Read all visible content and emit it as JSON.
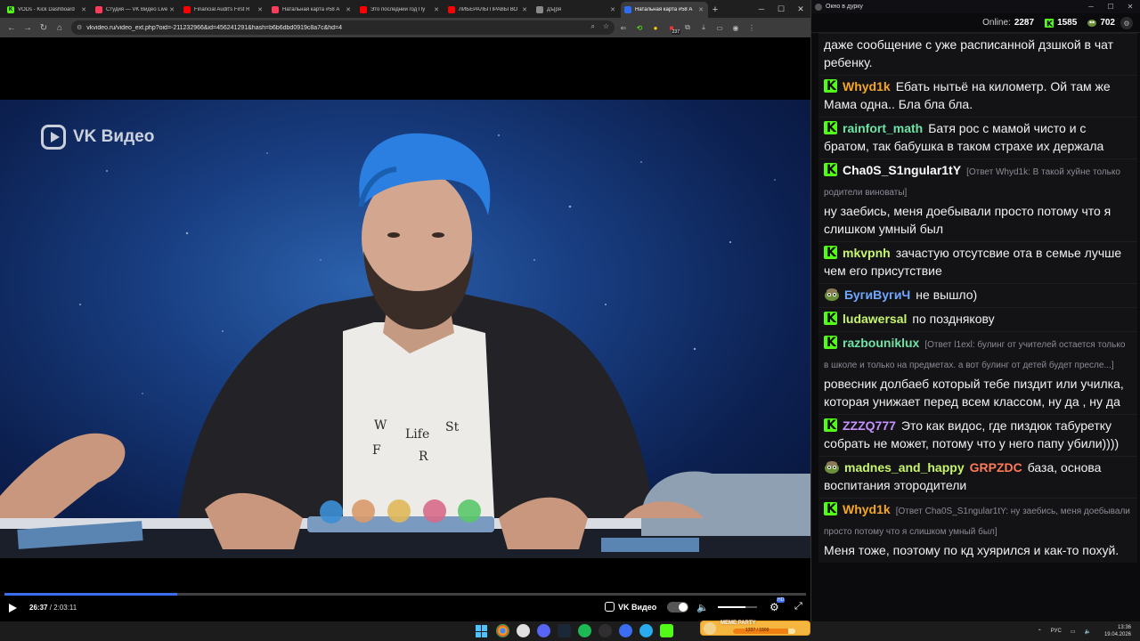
{
  "browser": {
    "tabs": [
      {
        "label": "VODs - Kick Dashboard",
        "icon": "kick-icon",
        "color": "#53fc18",
        "active": false
      },
      {
        "label": "Студия — VK Видео Live",
        "icon": "vk-studio-icon",
        "color": "#ff3b5c",
        "active": false
      },
      {
        "label": "Financial Audit's First R",
        "icon": "youtube-icon",
        "color": "#ff0000",
        "active": false
      },
      {
        "label": "Натальная карта #58 А",
        "icon": "vk-video-icon",
        "color": "#ff3b5c",
        "active": false
      },
      {
        "label": "Это последний год Пу",
        "icon": "youtube-icon",
        "color": "#ff0000",
        "active": false
      },
      {
        "label": "ЛИБЕРАЛЫ ПРАВЫ ВО",
        "icon": "youtube-icon",
        "color": "#ff0000",
        "active": false
      },
      {
        "label": "Дъ[ря",
        "icon": "generic-page-icon",
        "color": "#888888",
        "active": false
      },
      {
        "label": "Натальная карта #58 А",
        "icon": "vk-video-icon",
        "color": "#2f6cf5",
        "active": true
      }
    ],
    "url": "vkvideo.ru/video_ext.php?oid=-211232966&id=456241291&hash=b6b6dbd0919c8a7c&hd=4",
    "extension_badge": "237"
  },
  "video": {
    "watermark": "VK Видео",
    "current_time": "26:37",
    "separator": " / ",
    "total_time": "2:03:11",
    "progress": 0.216,
    "brand_label": "VK Видео",
    "volume": 0.7,
    "quality_badge": "HD"
  },
  "chat_window": {
    "title": "Окно в дурку",
    "online_label": "Online:",
    "online_count": "2287",
    "stat1": "1585",
    "stat2": "702",
    "messages": [
      {
        "badge": "none",
        "user": "",
        "user_color": "#ffffff",
        "reply": "",
        "text": "даже сообщение с уже расписанной дзшкой в чат ребенку."
      },
      {
        "badge": "kick",
        "user": "Whyd1k",
        "user_color": "#f5a623",
        "reply": "",
        "text": "Ебать нытьё на километр. Ой там же Мама одна.. Бла бла бла."
      },
      {
        "badge": "kick",
        "user": "rainfort_math",
        "user_color": "#6fe3a5",
        "reply": "",
        "text": "Батя рос с мамой чисто и с братом, так бабушка в таком страхе их держала"
      },
      {
        "badge": "kick",
        "user": "Cha0S_S1ngular1tY",
        "user_color": "#ffffff",
        "reply": "[Ответ Whyd1k: В такой хуйне только родители виноваты]",
        "text": "ну заебись, меня доебывали просто потому что я слишком умный был"
      },
      {
        "badge": "kick",
        "user": "mkvpnh",
        "user_color": "#c8f56b",
        "reply": "",
        "text": "зачастую отсутсвие ота в семье лучше чем его присутствие"
      },
      {
        "badge": "pepe",
        "user": "БугиВугиЧ",
        "user_color": "#6fa8ff",
        "reply": "",
        "text": "не вышло)"
      },
      {
        "badge": "kick",
        "user": "ludawersal",
        "user_color": "#c8f56b",
        "reply": "",
        "text": "по позднякову"
      },
      {
        "badge": "kick",
        "user": "razbouniklux",
        "user_color": "#6fe3a5",
        "reply": "[Ответ l1exl: булинг от учителей остается только в школе и только на предметах. а вот булинг от детей будет пресле...]",
        "text": "ровесник долбаеб который тебе пиздит или училка, которая унижает перед всем классом, ну да , ну да"
      },
      {
        "badge": "kick",
        "user": "ZZZQ777",
        "user_color": "#c792ff",
        "reply": "",
        "text": "Это как видос, где пиздюк табуретку собрать не может, потому что у него папу убили))))"
      },
      {
        "badge": "pepe",
        "user": "madnes_and_happy",
        "user_color": "#c8f56b",
        "mention": "GRPZDC",
        "mention_color": "#ff7a59",
        "reply": "",
        "text": "база, основа воспитания этородители"
      },
      {
        "badge": "kick",
        "user": "Whyd1k",
        "user_color": "#f5a623",
        "reply": "[Ответ Cha0S_S1ngular1tY: ну заебись, меня доебывали просто потому что я слишком умный был]",
        "text": "Меня тоже, поэтому по кд хуярился и как-то похуй."
      }
    ]
  },
  "taskbar": {
    "meme_title": "MEME PARTY",
    "meme_progress": "1337 / 1500",
    "meme_fraction": 0.89,
    "lang": "РУС",
    "time": "13:36",
    "date": "19.04.2026"
  },
  "colors": {
    "kick_green": "#53fc18",
    "vk_blue": "#2f6cf5",
    "accent_orange": "#f07f12"
  }
}
